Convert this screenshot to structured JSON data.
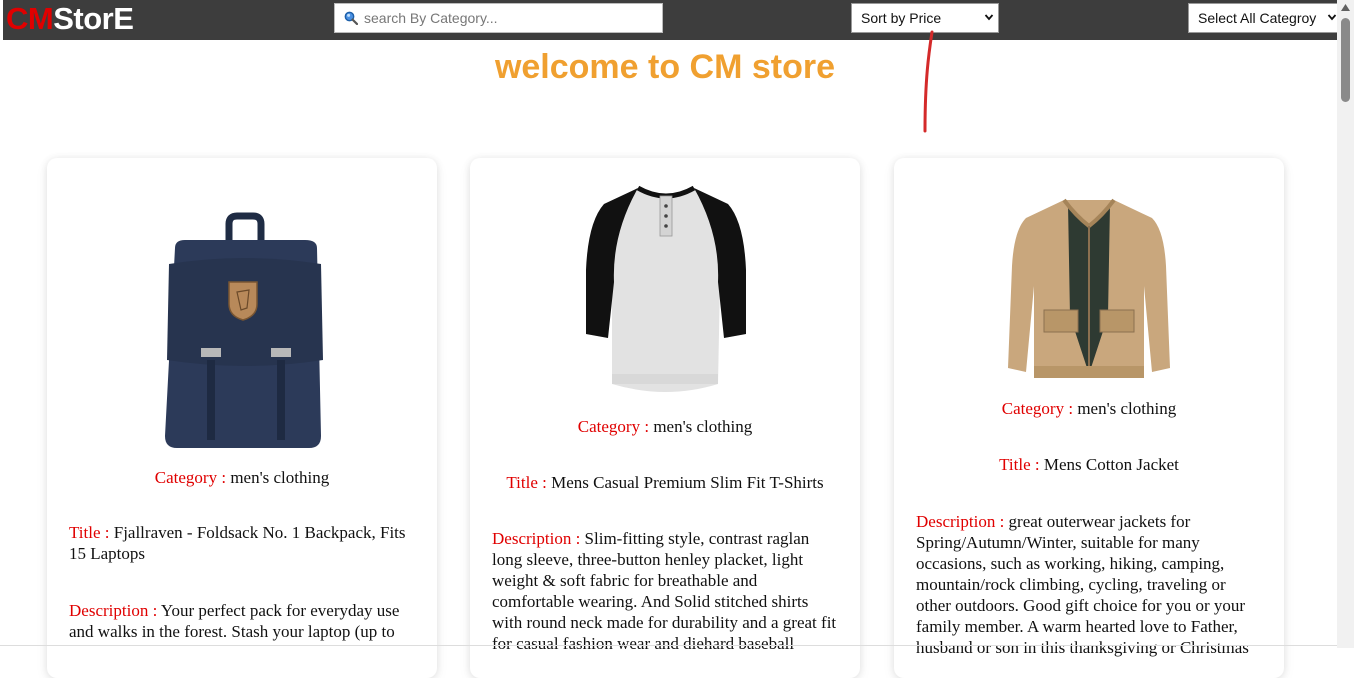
{
  "brand": {
    "prefix": "CM",
    "suffix": "StorE"
  },
  "search": {
    "placeholder": "search By Category..."
  },
  "sort": {
    "selected": "Sort by Price"
  },
  "category_filter": {
    "selected": "Select All Categroy"
  },
  "welcome": "welcome to CM store",
  "labels": {
    "category": "Category : ",
    "title": "Title : ",
    "description": "Description : "
  },
  "products": [
    {
      "category": "men's clothing",
      "title": "Fjallraven - Foldsack No. 1 Backpack, Fits 15 Laptops",
      "description": "Your perfect pack for everyday use and walks in the forest. Stash your laptop (up to",
      "image_icon": "backpack-image"
    },
    {
      "category": "men's clothing",
      "title": "Mens Casual Premium Slim Fit T-Shirts",
      "description": "Slim-fitting style, contrast raglan long sleeve, three-button henley placket, light weight & soft fabric for breathable and comfortable wearing. And Solid stitched shirts with round neck made for durability and a great fit for casual fashion wear and diehard baseball",
      "image_icon": "tshirt-image"
    },
    {
      "category": "men's clothing",
      "title": "Mens Cotton Jacket",
      "description": "great outerwear jackets for Spring/Autumn/Winter, suitable for many occasions, such as working, hiking, camping, mountain/rock climbing, cycling, traveling or other outdoors. Good gift choice for you or your family member. A warm hearted love to Father, husband or son in this thanksgiving or Christmas",
      "image_icon": "jacket-image"
    }
  ],
  "colors": {
    "navbar": "#3d3d3d",
    "brand_red": "#e00000",
    "welcome": "#f0a030",
    "label_red": "#e00000"
  }
}
